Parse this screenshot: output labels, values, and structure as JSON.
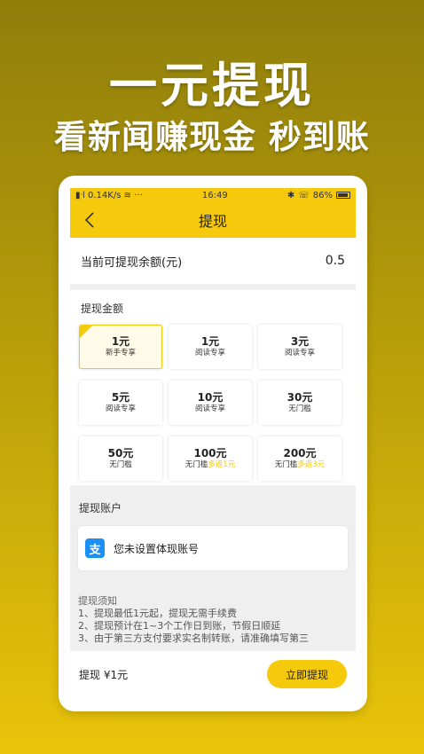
{
  "promo": {
    "title": "一元提现",
    "subtitle": "看新闻赚现金 秒到账"
  },
  "status_bar": {
    "left": "􀀁l 0.14K/s ᯤ ···",
    "time": "16:49",
    "right": "✱ ⚭ 86%"
  },
  "nav": {
    "title": "提现",
    "back_icon": "chevron-left-icon"
  },
  "balance": {
    "label": "当前可提现余额(元)",
    "value": "0.5"
  },
  "amounts": {
    "label": "提现金额",
    "options": [
      {
        "amount": "1元",
        "desc": "新手专享",
        "extra": "",
        "selected": true
      },
      {
        "amount": "1元",
        "desc": "阅读专享",
        "extra": "",
        "selected": false
      },
      {
        "amount": "3元",
        "desc": "阅读专享",
        "extra": "",
        "selected": false
      },
      {
        "amount": "5元",
        "desc": "阅读专享",
        "extra": "",
        "selected": false
      },
      {
        "amount": "10元",
        "desc": "阅读专享",
        "extra": "",
        "selected": false
      },
      {
        "amount": "30元",
        "desc": "无门槛",
        "extra": "",
        "selected": false
      },
      {
        "amount": "50元",
        "desc": "无门槛",
        "extra": "",
        "selected": false
      },
      {
        "amount": "100元",
        "desc": "无门槛",
        "extra": "多返1元",
        "selected": false
      },
      {
        "amount": "200元",
        "desc": "无门槛",
        "extra": "多返3元",
        "selected": false
      }
    ]
  },
  "account": {
    "label": "提现账户",
    "icon": "alipay-icon",
    "icon_glyph": "支",
    "text": "您未设置体现账号"
  },
  "notice": {
    "title": "提现须知",
    "lines": [
      "1、提现最低1元起，提现无需手续费",
      "2、提现预计在1~3个工作日到账，节假日顺延",
      "3、由于第三方支付要求实名制转账，请准确填写第三"
    ]
  },
  "footer": {
    "amount_text": "提现 ¥1元",
    "button_label": "立即提现"
  },
  "colors": {
    "accent": "#f5c90c",
    "alipay": "#1c8ff5"
  }
}
